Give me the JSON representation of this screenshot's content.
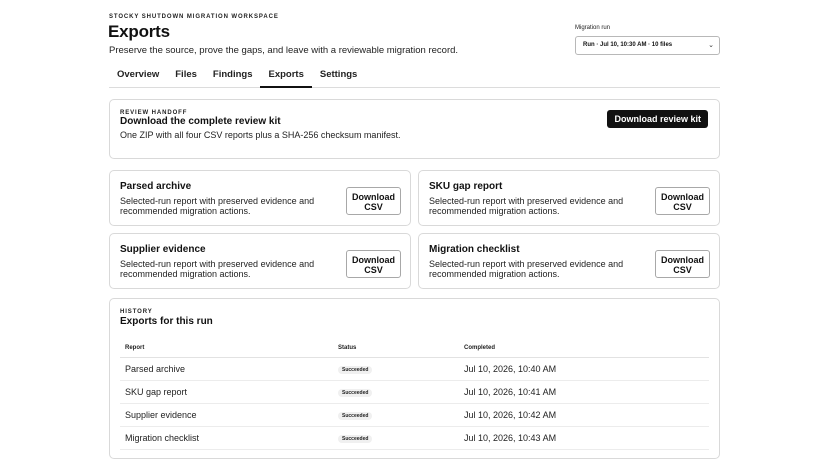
{
  "header": {
    "kicker": "STOCKY SHUTDOWN MIGRATION WORKSPACE",
    "title": "Exports",
    "subtitle": "Preserve the source, prove the gaps, and leave with a reviewable migration record."
  },
  "run_picker": {
    "label": "Migration run",
    "selected": "Run · Jul 10, 10:30 AM · 10 files"
  },
  "tabs": [
    {
      "label": "Overview",
      "active": false
    },
    {
      "label": "Files",
      "active": false
    },
    {
      "label": "Findings",
      "active": false
    },
    {
      "label": "Exports",
      "active": true
    },
    {
      "label": "Settings",
      "active": false
    }
  ],
  "handoff": {
    "eyebrow": "REVIEW HANDOFF",
    "title": "Download the complete review kit",
    "description": "One ZIP with all four CSV reports plus a SHA-256 checksum manifest.",
    "button": "Download review kit"
  },
  "reports": [
    {
      "title": "Parsed archive",
      "description": "Selected-run report with preserved evidence and recommended migration actions.",
      "button_line1": "Download",
      "button_line2": "CSV"
    },
    {
      "title": "SKU gap report",
      "description": "Selected-run report with preserved evidence and recommended migration actions.",
      "button_line1": "Download",
      "button_line2": "CSV"
    },
    {
      "title": "Supplier evidence",
      "description": "Selected-run report with preserved evidence and recommended migration actions.",
      "button_line1": "Download",
      "button_line2": "CSV"
    },
    {
      "title": "Migration checklist",
      "description": "Selected-run report with preserved evidence and recommended migration actions.",
      "button_line1": "Download",
      "button_line2": "CSV"
    }
  ],
  "history": {
    "eyebrow": "HISTORY",
    "title": "Exports for this run",
    "columns": [
      "Report",
      "Status",
      "Completed"
    ],
    "rows": [
      {
        "report": "Parsed archive",
        "status": "Succeeded",
        "completed": "Jul 10, 2026, 10:40 AM"
      },
      {
        "report": "SKU gap report",
        "status": "Succeeded",
        "completed": "Jul 10, 2026, 10:41 AM"
      },
      {
        "report": "Supplier evidence",
        "status": "Succeeded",
        "completed": "Jul 10, 2026, 10:42 AM"
      },
      {
        "report": "Migration checklist",
        "status": "Succeeded",
        "completed": "Jul 10, 2026, 10:43 AM"
      }
    ]
  }
}
